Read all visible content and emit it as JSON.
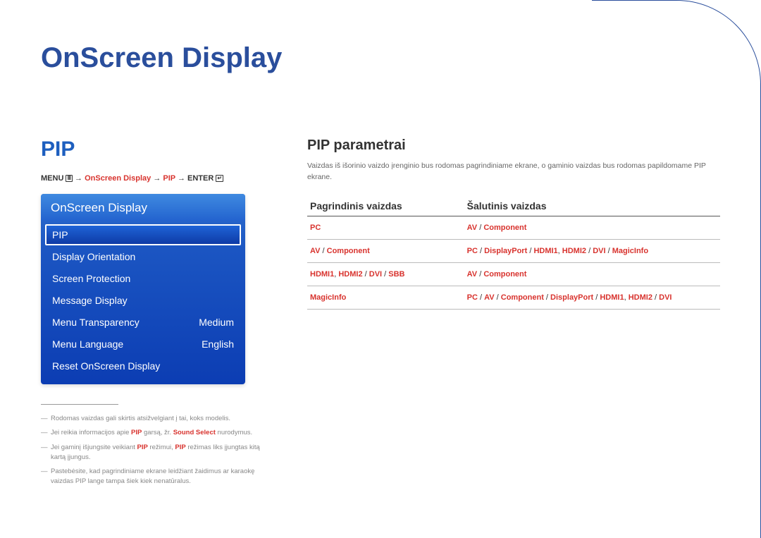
{
  "header": {
    "main_title": "OnScreen Display"
  },
  "left": {
    "section_title": "PIP",
    "breadcrumb": {
      "menu": "MENU",
      "arrow": "→",
      "path1": "OnScreen Display",
      "path2": "PIP",
      "enter": "ENTER"
    },
    "osd": {
      "title": "OnScreen Display",
      "items": [
        {
          "label": "PIP",
          "value": "",
          "selected": true
        },
        {
          "label": "Display Orientation",
          "value": "",
          "selected": false
        },
        {
          "label": "Screen Protection",
          "value": "",
          "selected": false
        },
        {
          "label": "Message Display",
          "value": "",
          "selected": false
        },
        {
          "label": "Menu Transparency",
          "value": "Medium",
          "selected": false
        },
        {
          "label": "Menu Language",
          "value": "English",
          "selected": false
        },
        {
          "label": "Reset OnScreen Display",
          "value": "",
          "selected": false
        }
      ]
    },
    "footnotes": {
      "n1": "Rodomas vaizdas gali skirtis atsižvelgiant į tai, koks modelis.",
      "n2_a": "Jei reikia informacijos apie ",
      "n2_pip": "PIP",
      "n2_b": " garsą, žr. ",
      "n2_ss": "Sound Select",
      "n2_c": " nurodymus.",
      "n3_a": "Jei gaminį išjungsite veikiant ",
      "n3_pip1": "PIP",
      "n3_b": " režimui, ",
      "n3_pip2": "PIP",
      "n3_c": " režimas liks įjungtas kitą kartą įjungus.",
      "n4": "Pastebėsite, kad pagrindiniame ekrane leidžiant žaidimus ar karaokę vaizdas PIP lange tampa šiek kiek nenatūralus."
    }
  },
  "right": {
    "title": "PIP parametrai",
    "desc": "Vaizdas iš išorinio vaizdo įrenginio bus rodomas pagrindiniame ekrane, o gaminio vaizdas bus rodomas papildomame PIP ekrane.",
    "table": {
      "head": {
        "col1": "Pagrindinis vaizdas",
        "col2": "Šalutinis vaizdas"
      },
      "rows": [
        {
          "c1_tokens": [
            {
              "t": "PC"
            }
          ],
          "c2_tokens": [
            {
              "t": "AV"
            },
            {
              "sep": " / "
            },
            {
              "t": "Component"
            }
          ]
        },
        {
          "c1_tokens": [
            {
              "t": "AV"
            },
            {
              "sep": " / "
            },
            {
              "t": "Component"
            }
          ],
          "c2_tokens": [
            {
              "t": "PC"
            },
            {
              "sep": " / "
            },
            {
              "t": "DisplayPort"
            },
            {
              "sep": " / "
            },
            {
              "t": "HDMI1"
            },
            {
              "sep": ", "
            },
            {
              "t": "HDMI2"
            },
            {
              "sep": " / "
            },
            {
              "t": "DVI"
            },
            {
              "sep": " / "
            },
            {
              "t": "MagicInfo"
            }
          ]
        },
        {
          "c1_tokens": [
            {
              "t": "HDMI1"
            },
            {
              "sep": ", "
            },
            {
              "t": "HDMI2"
            },
            {
              "sep": " / "
            },
            {
              "t": "DVI"
            },
            {
              "sep": " / "
            },
            {
              "t": "SBB"
            }
          ],
          "c2_tokens": [
            {
              "t": "AV"
            },
            {
              "sep": " / "
            },
            {
              "t": "Component"
            }
          ]
        },
        {
          "c1_tokens": [
            {
              "t": "MagicInfo"
            }
          ],
          "c2_tokens": [
            {
              "t": "PC"
            },
            {
              "sep": " / "
            },
            {
              "t": "AV"
            },
            {
              "sep": " / "
            },
            {
              "t": "Component"
            },
            {
              "sep": " / "
            },
            {
              "t": "DisplayPort"
            },
            {
              "sep": " / "
            },
            {
              "t": "HDMI1"
            },
            {
              "sep": ", "
            },
            {
              "t": "HDMI2"
            },
            {
              "sep": " / "
            },
            {
              "t": "DVI"
            }
          ]
        }
      ]
    }
  }
}
